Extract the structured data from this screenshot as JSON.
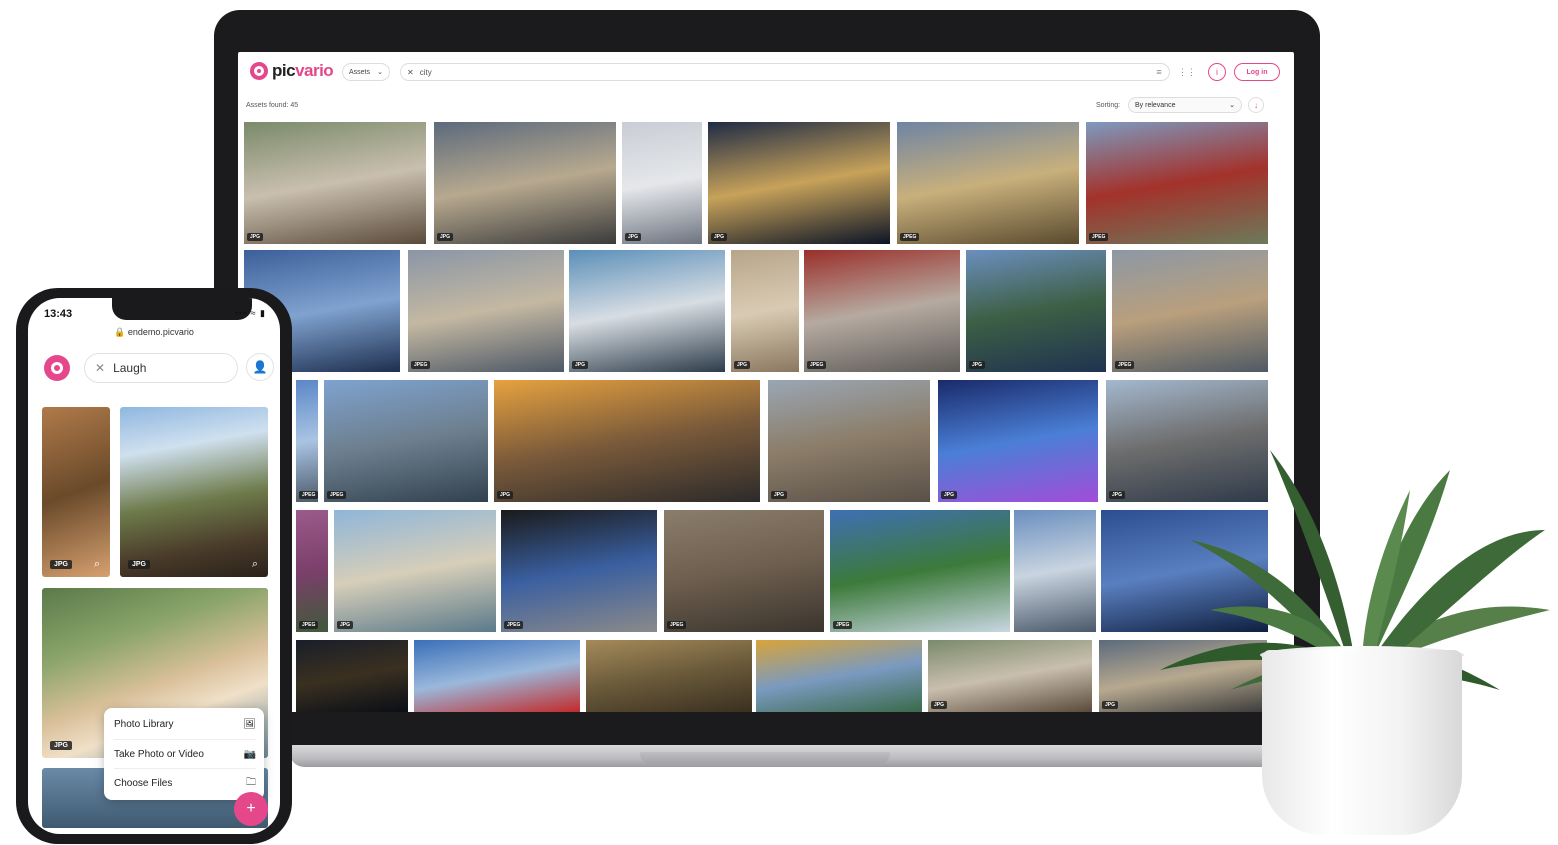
{
  "laptop_app": {
    "logo_text_dark": "pic",
    "logo_text_accent": "vario",
    "scope_label": "Assets",
    "search_value": "city",
    "login_label": "Log in",
    "assets_found": "Assets found: 45",
    "sorting_label": "Sorting:",
    "sorting_value": "By relevance",
    "thumbs": [
      {
        "badge": "JPG",
        "colors": [
          "#7a8a6a",
          "#c9bfae",
          "#5a4a3a"
        ]
      },
      {
        "badge": "JPG",
        "colors": [
          "#5c6a7c",
          "#b7a98f",
          "#3b3b3b"
        ]
      },
      {
        "badge": "JPG",
        "colors": [
          "#c9cdd4",
          "#e5e7ea",
          "#6d7480"
        ]
      },
      {
        "badge": "JPG",
        "colors": [
          "#1f2b45",
          "#c7a25a",
          "#0c1426"
        ]
      },
      {
        "badge": "JPEG",
        "colors": [
          "#6f84a3",
          "#c8b07c",
          "#5a4a2e"
        ]
      },
      {
        "badge": "JPEG",
        "colors": [
          "#7d9ac0",
          "#a3322b",
          "#6c7a5a"
        ]
      },
      {
        "badge": "JPG",
        "colors": [
          "#3c5f9a",
          "#7fa2cf",
          "#1e2f4f"
        ]
      },
      {
        "badge": "JPEG",
        "colors": [
          "#8a96a6",
          "#c4b8a2",
          "#4d5866"
        ]
      },
      {
        "badge": "JPG",
        "colors": [
          "#5b8fb9",
          "#d7dde3",
          "#2d3c4a"
        ]
      },
      {
        "badge": "JPG",
        "colors": [
          "#b7a58a",
          "#d9cbb3",
          "#8a7760"
        ]
      },
      {
        "badge": "JPEG",
        "colors": [
          "#9a2f2a",
          "#b6aaa0",
          "#5c5a58"
        ]
      },
      {
        "badge": "JPG",
        "colors": [
          "#6b8fbf",
          "#3d5f45",
          "#1f3350"
        ]
      },
      {
        "badge": "JPEG",
        "colors": [
          "#8c98a5",
          "#b99f7d",
          "#4f5a64"
        ]
      },
      {
        "badge": "JPEG",
        "colors": [
          "#5b87c7",
          "#a9c4e3",
          "#4c5b6a"
        ]
      },
      {
        "badge": "JPEG",
        "colors": [
          "#7ea2cf",
          "#6d7f8e",
          "#324150"
        ]
      },
      {
        "badge": "JPG",
        "colors": [
          "#e7a23f",
          "#7a5a3a",
          "#2c2a2a"
        ]
      },
      {
        "badge": "JPG",
        "colors": [
          "#9aa6b4",
          "#8b7d68",
          "#5a5048"
        ]
      },
      {
        "badge": "JPG",
        "colors": [
          "#1a2a6a",
          "#4a7fd6",
          "#a24dd9"
        ]
      },
      {
        "badge": "JPG",
        "colors": [
          "#a4b8cf",
          "#6d6d6d",
          "#2f3b4a"
        ]
      },
      {
        "badge": "JPEG",
        "colors": [
          "#9b5a8b",
          "#7b3f6a",
          "#3f5a3a"
        ]
      },
      {
        "badge": "JPG",
        "colors": [
          "#8fb6d9",
          "#d6ceb9",
          "#5b7a8a"
        ]
      },
      {
        "badge": "JPEG",
        "colors": [
          "#1a1a1a",
          "#3a5fa0",
          "#8a8a8a"
        ]
      },
      {
        "badge": "JPEG",
        "colors": [
          "#8b7d6b",
          "#6d5e4e",
          "#3b352e"
        ]
      },
      {
        "badge": "JPEG",
        "colors": [
          "#3f6fb4",
          "#3c7a3a",
          "#c9d6e2"
        ]
      },
      {
        "badge": "",
        "colors": [
          "#6a8fbf",
          "#c9d4e0",
          "#4a5868"
        ]
      },
      {
        "badge": "",
        "colors": [
          "#2b4e8f",
          "#5a7fc0",
          "#0f1f3f"
        ]
      },
      {
        "badge": "",
        "colors": [
          "#1a1e2a",
          "#3a3020",
          "#0a0e16"
        ]
      },
      {
        "badge": "",
        "colors": [
          "#3a6fb9",
          "#9ab8db",
          "#c22a2a"
        ]
      },
      {
        "badge": "",
        "colors": [
          "#a58a5a",
          "#6a5a3a",
          "#3a3020"
        ]
      },
      {
        "badge": "",
        "colors": [
          "#d8a43a",
          "#7a9ac0",
          "#3a6a4a"
        ]
      }
    ]
  },
  "phone_app": {
    "time": "13:43",
    "status_icons": "••• ≈ ▮",
    "url": "🔒 endemo.picvario",
    "search_value": "Laugh",
    "thumb_badges": [
      "JPG",
      "JPG",
      "JPG"
    ],
    "menu": [
      {
        "label": "Photo Library",
        "icon": "🖼"
      },
      {
        "label": "Take Photo or Video",
        "icon": "📷"
      },
      {
        "label": "Choose Files",
        "icon": "🗀"
      }
    ],
    "fab_label": "+"
  }
}
